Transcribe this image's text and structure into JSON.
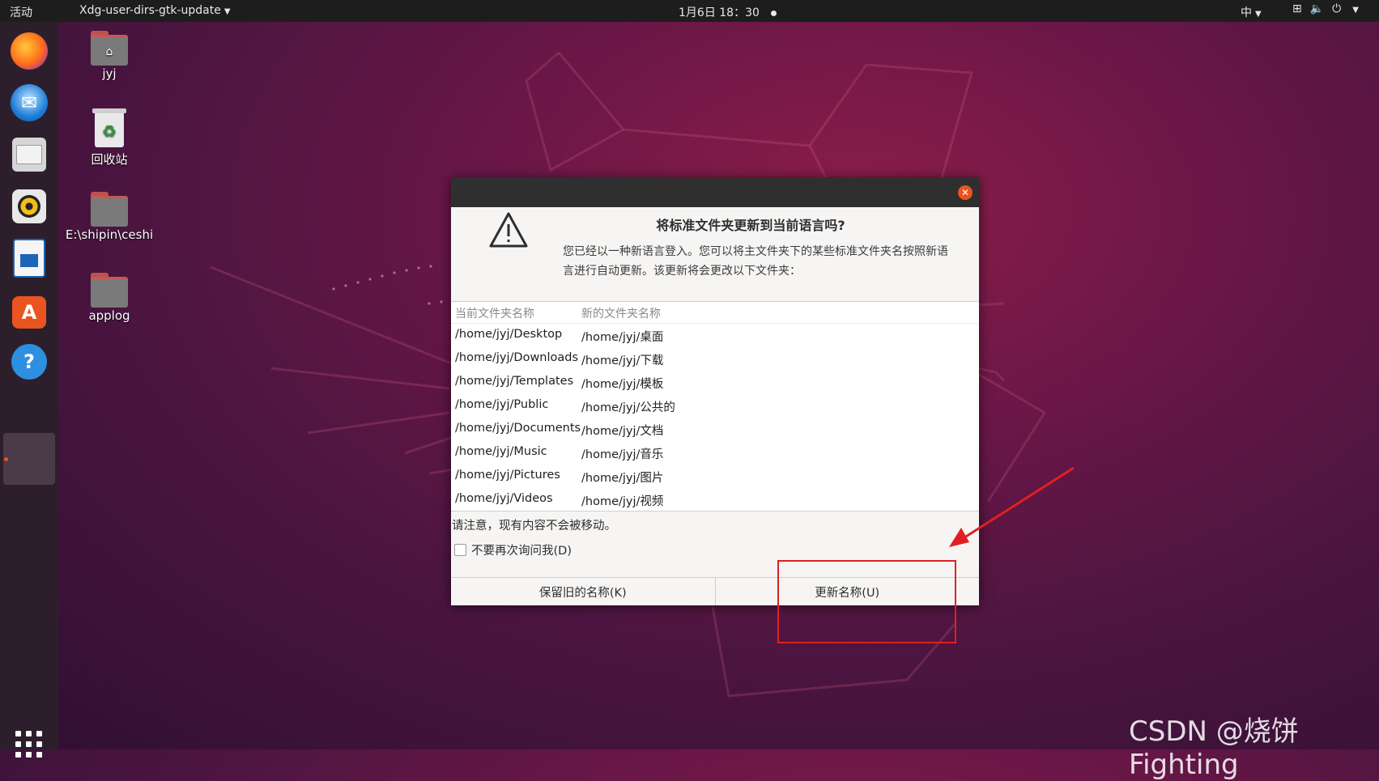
{
  "topbar": {
    "activities": "活动",
    "app_menu": "Xdg-user-dirs-gtk-update",
    "clock": "1月6日  18：30",
    "input_method": "中"
  },
  "desktop": {
    "items": [
      {
        "label": "jyj"
      },
      {
        "label": "回收站"
      },
      {
        "label": "E:\\shipin\\ceshi"
      },
      {
        "label": "applog"
      }
    ]
  },
  "dock": {
    "apps": [
      "firefox-icon",
      "thunderbird-icon",
      "files-icon",
      "rhythmbox-icon",
      "libreoffice-writer-icon",
      "ubuntu-software-icon",
      "help-icon"
    ]
  },
  "dialog": {
    "heading": "将标准文件夹更新到当前语言吗?",
    "description": "您已经以一种新语言登入。您可以将主文件夹下的某些标准文件夹名按照新语言进行自动更新。该更新将会更改以下文件夹：",
    "columns": [
      "当前文件夹名称",
      "新的文件夹名称"
    ],
    "rows": [
      {
        "current": "/home/jyj/Desktop",
        "new": "/home/jyj/桌面"
      },
      {
        "current": "/home/jyj/Downloads",
        "new": "/home/jyj/下载"
      },
      {
        "current": "/home/jyj/Templates",
        "new": "/home/jyj/模板"
      },
      {
        "current": "/home/jyj/Public",
        "new": "/home/jyj/公共的"
      },
      {
        "current": "/home/jyj/Documents",
        "new": "/home/jyj/文档"
      },
      {
        "current": "/home/jyj/Music",
        "new": "/home/jyj/音乐"
      },
      {
        "current": "/home/jyj/Pictures",
        "new": "/home/jyj/图片"
      },
      {
        "current": "/home/jyj/Videos",
        "new": "/home/jyj/视频"
      }
    ],
    "note": "请注意，现有内容不会被移动。",
    "checkbox_label": "不要再次询问我(D)",
    "keep_button": "保留旧的名称(K)",
    "update_button": "更新名称(U)"
  },
  "watermark": "CSDN @烧饼Fighting",
  "colors": {
    "accent": "#e95420",
    "annotation": "#e02020"
  }
}
